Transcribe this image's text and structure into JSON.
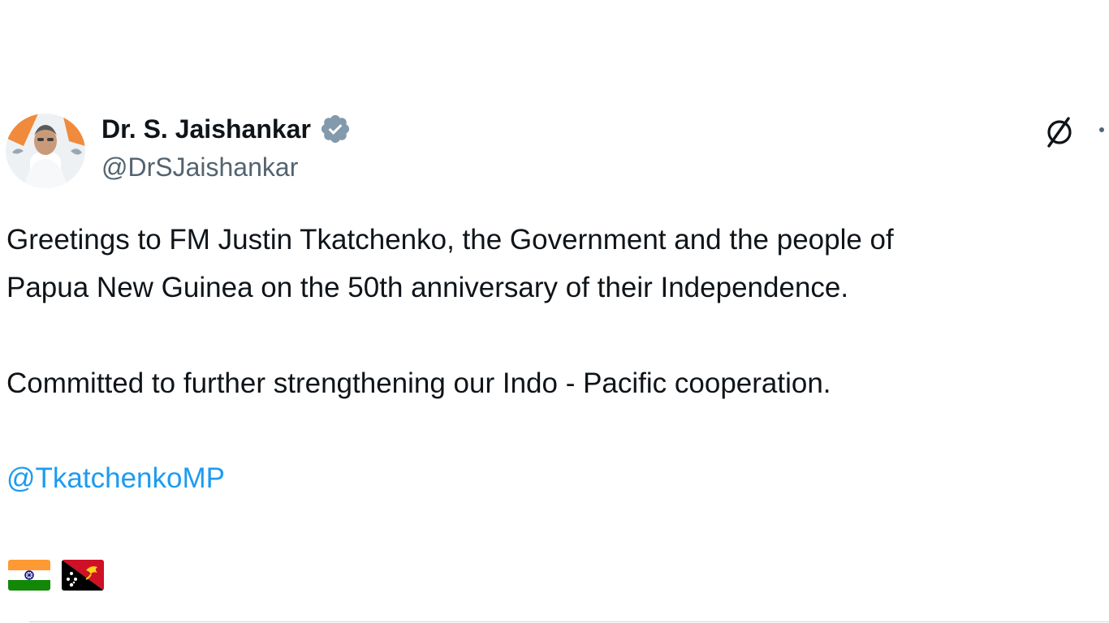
{
  "author": {
    "display_name": "Dr. S. Jaishankar",
    "handle": "@DrSJaishankar",
    "verified": true,
    "verified_color": "#829aab"
  },
  "actions": {
    "grok_icon": "grok-icon",
    "more_icon": "more-options-icon"
  },
  "tweet": {
    "line1": "Greetings to FM Justin Tkatchenko, the Government and the people of",
    "line2": "Papua New Guinea on the 50th anniversary of their Independence.",
    "line3": "Committed to further strengthening our Indo - Pacific cooperation.",
    "mention": "@TkatchenkoMP",
    "flags": [
      "india-flag",
      "papua-new-guinea-flag"
    ]
  },
  "colors": {
    "text": "#0f1419",
    "secondary": "#536471",
    "link": "#1d9bf0",
    "divider": "#cfd9de"
  }
}
